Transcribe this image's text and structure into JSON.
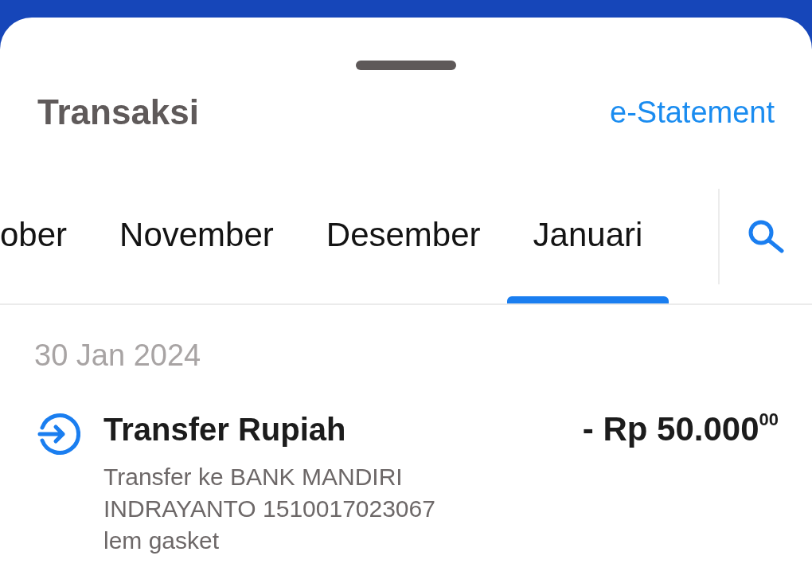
{
  "header": {
    "title": "Transaksi",
    "link": "e-Statement"
  },
  "tabs": [
    {
      "label": "ober",
      "selected": false
    },
    {
      "label": "November",
      "selected": false
    },
    {
      "label": "Desember",
      "selected": false
    },
    {
      "label": "Januari",
      "selected": true
    }
  ],
  "transaction_groups": [
    {
      "date": "30 Jan 2024",
      "transactions": [
        {
          "title": "Transfer Rupiah",
          "amount": "- Rp 50.000$^{00}$",
          "details": [
            "Transfer ke BANK MANDIRI",
            "INDRAYANTO 1510017023067",
            "lem gasket"
          ]
        }
      ]
    }
  ]
}
